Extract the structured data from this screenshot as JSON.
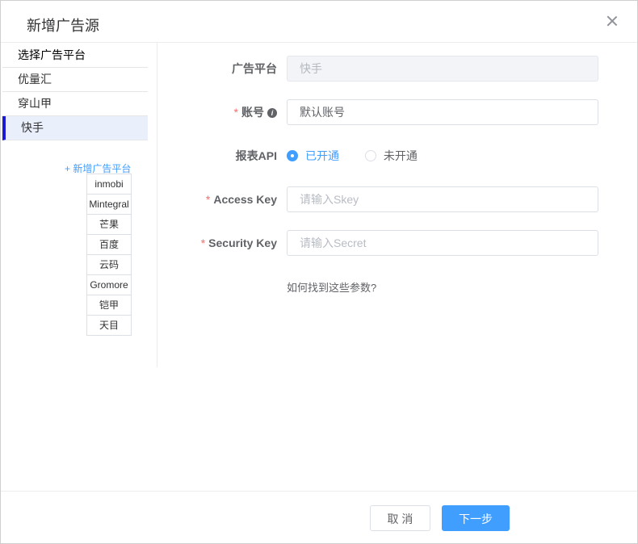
{
  "dialog": {
    "title": "新增广告源",
    "close_icon": "close-icon"
  },
  "sidebar": {
    "header": "选择广告平台",
    "items": [
      {
        "label": "优量汇",
        "active": false
      },
      {
        "label": "穿山甲",
        "active": false
      },
      {
        "label": "快手",
        "active": true
      }
    ],
    "add_platform": "+ 新增广告平台",
    "platform_options": [
      "inmobi",
      "Mintegral",
      "芒果",
      "百度",
      "云码",
      "Gromore",
      "铠甲",
      "天目"
    ]
  },
  "form": {
    "platform": {
      "label": "广告平台",
      "value": "快手"
    },
    "account": {
      "required_mark": "*",
      "label": "账号",
      "info_icon": "info-icon",
      "value": "默认账号"
    },
    "report_api": {
      "label": "报表API",
      "options": [
        {
          "label": "已开通",
          "checked": true
        },
        {
          "label": "未开通",
          "checked": false
        }
      ]
    },
    "access_key": {
      "required_mark": "*",
      "label": "Access Key",
      "placeholder": "请输入Skey"
    },
    "security_key": {
      "required_mark": "*",
      "label": "Security Key",
      "placeholder": "请输入Secret"
    },
    "help_link": "如何找到这些参数?"
  },
  "footer": {
    "cancel": "取 消",
    "next": "下一步"
  },
  "colors": {
    "primary": "#409eff",
    "active_bar": "#1a1ad6",
    "required": "#f56c6c"
  }
}
